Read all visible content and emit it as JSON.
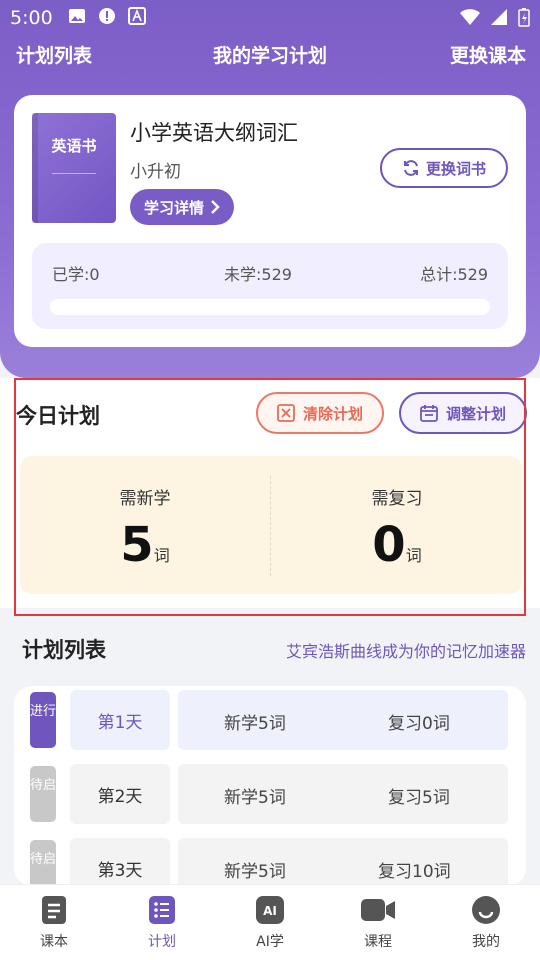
{
  "status_bar": {
    "time": "5:00"
  },
  "nav": {
    "left": "计划列表",
    "title": "我的学习计划",
    "right": "更换课本"
  },
  "book": {
    "cover_text": "英语书",
    "title": "小学英语大纲词汇",
    "level": "小升初",
    "detail_button": "学习详情",
    "swap_button": "更换词书",
    "learned": "已学:0",
    "unlearned": "未学:529",
    "total": "总计:529",
    "progress": 0
  },
  "today": {
    "title": "今日计划",
    "clear_button": "清除计划",
    "adjust_button": "调整计划",
    "new_label": "需新学",
    "new_count": "5",
    "review_label": "需复习",
    "review_count": "0",
    "unit": "词"
  },
  "plan": {
    "title": "计划列表",
    "subtitle": "艾宾浩斯曲线成为你的记忆加速器",
    "rows": [
      {
        "status": "进行",
        "day": "第1天",
        "new": "新学5词",
        "review": "复习0词"
      },
      {
        "status": "待启",
        "day": "第2天",
        "new": "新学5词",
        "review": "复习5词"
      },
      {
        "status": "待启",
        "day": "第3天",
        "new": "新学5词",
        "review": "复习10词"
      }
    ]
  },
  "tabs": [
    {
      "label": "课本",
      "icon": "book-icon"
    },
    {
      "label": "计划",
      "icon": "list-icon"
    },
    {
      "label": "AI学",
      "icon": "ai-icon"
    },
    {
      "label": "课程",
      "icon": "video-icon"
    },
    {
      "label": "我的",
      "icon": "profile-icon"
    }
  ],
  "colors": {
    "primary": "#7a5cc6",
    "accent_red": "#ea6a55",
    "today_bg": "#fdf5e2"
  }
}
